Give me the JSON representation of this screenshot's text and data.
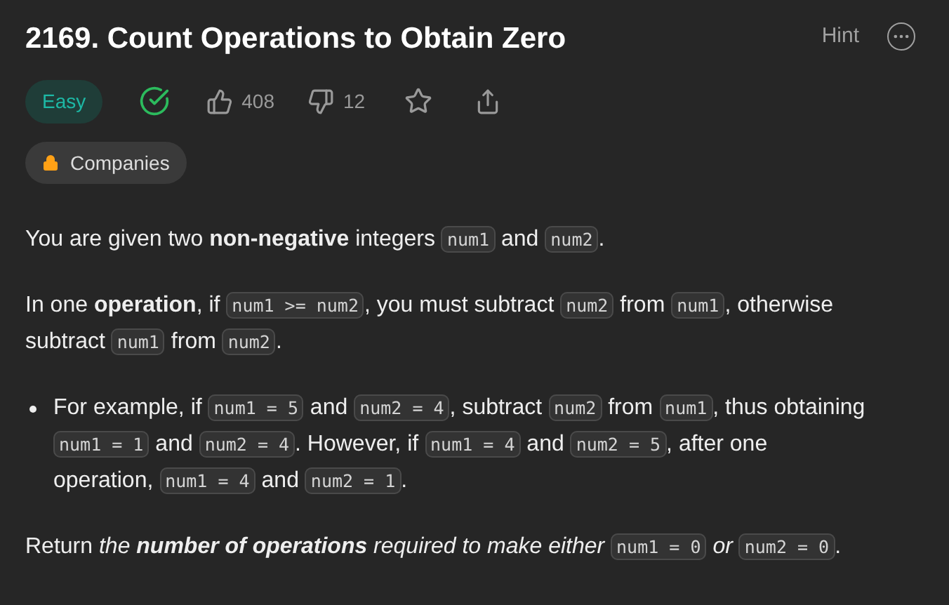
{
  "title": "2169. Count Operations to Obtain Zero",
  "hint": "Hint",
  "difficulty": "Easy",
  "solved": true,
  "likes": "408",
  "dislikes": "12",
  "favorited": false,
  "companies": "Companies",
  "paragraphs": [
    {
      "kind": "text",
      "segments": [
        {
          "kind": "text",
          "text": "You are given two **non-negative** integers "
        },
        {
          "kind": "code",
          "text": "num1"
        },
        {
          "kind": "text",
          "text": " and "
        },
        {
          "kind": "code",
          "text": "num2"
        },
        {
          "kind": "text",
          "text": "."
        }
      ]
    },
    {
      "kind": "text",
      "segments": [
        {
          "kind": "text",
          "text": "In one **operation**, if "
        },
        {
          "kind": "code",
          "text": "num1 >= num2"
        },
        {
          "kind": "text",
          "text": ", you must subtract "
        },
        {
          "kind": "code",
          "text": "num2"
        },
        {
          "kind": "text",
          "text": " from "
        },
        {
          "kind": "code",
          "text": "num1"
        },
        {
          "kind": "text",
          "text": ", otherwise subtract "
        },
        {
          "kind": "code",
          "text": "num1"
        },
        {
          "kind": "text",
          "text": " from "
        },
        {
          "kind": "code",
          "text": "num2"
        },
        {
          "kind": "text",
          "text": "."
        }
      ]
    },
    {
      "kind": "bullet",
      "segments": [
        {
          "kind": "text",
          "text": "For example, if "
        },
        {
          "kind": "code",
          "text": "num1 = 5"
        },
        {
          "kind": "text",
          "text": " and "
        },
        {
          "kind": "code",
          "text": "num2 = 4"
        },
        {
          "kind": "text",
          "text": ", subtract "
        },
        {
          "kind": "code",
          "text": "num2"
        },
        {
          "kind": "text",
          "text": " from "
        },
        {
          "kind": "code",
          "text": "num1"
        },
        {
          "kind": "text",
          "text": ", thus obtaining "
        },
        {
          "kind": "code",
          "text": "num1 = 1"
        },
        {
          "kind": "text",
          "text": " and "
        },
        {
          "kind": "code",
          "text": "num2 = 4"
        },
        {
          "kind": "text",
          "text": ". However, if "
        },
        {
          "kind": "code",
          "text": "num1 = 4"
        },
        {
          "kind": "text",
          "text": " and "
        },
        {
          "kind": "code",
          "text": "num2 = 5"
        },
        {
          "kind": "text",
          "text": ", after one operation, "
        },
        {
          "kind": "code",
          "text": "num1 = 4"
        },
        {
          "kind": "text",
          "text": " and "
        },
        {
          "kind": "code",
          "text": "num2 = 1"
        },
        {
          "kind": "text",
          "text": "."
        }
      ]
    },
    {
      "kind": "text",
      "segments": [
        {
          "kind": "text",
          "text": "Return "
        },
        {
          "kind": "italic",
          "text": "the **number of operations** required to make either "
        },
        {
          "kind": "code",
          "text": "num1 = 0"
        },
        {
          "kind": "italic",
          "text": " or "
        },
        {
          "kind": "code",
          "text": "num2 = 0"
        },
        {
          "kind": "text",
          "text": "."
        }
      ]
    }
  ]
}
